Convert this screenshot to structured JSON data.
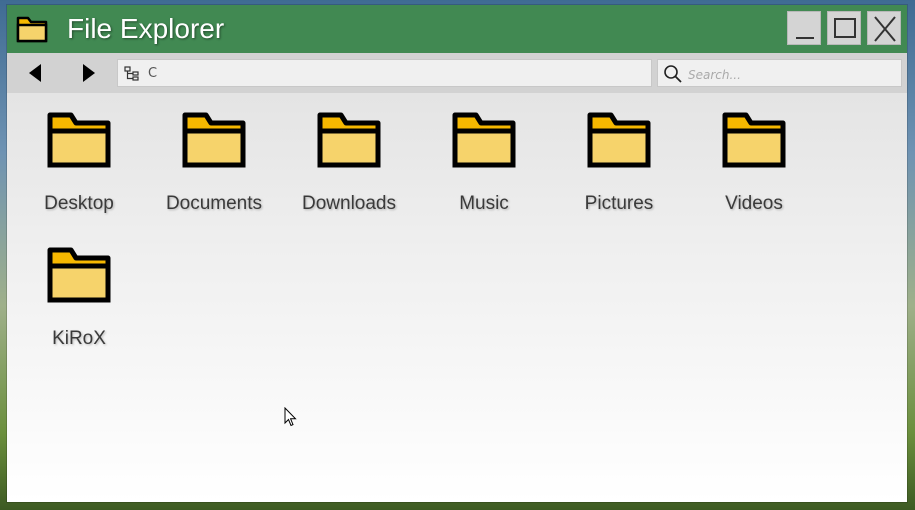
{
  "window": {
    "title": "File Explorer",
    "titlebar_color": "#418952",
    "controls": {
      "minimize": "_",
      "maximize": "□",
      "close": "X"
    }
  },
  "toolbar": {
    "back_icon": "triangle-left-icon",
    "forward_icon": "triangle-right-icon",
    "address": {
      "icon": "folder-tree-icon",
      "path": "C"
    },
    "search": {
      "icon": "magnifier-icon",
      "placeholder": "Search..."
    }
  },
  "folders": [
    {
      "label": "Desktop",
      "icon": "folder-icon"
    },
    {
      "label": "Documents",
      "icon": "folder-icon"
    },
    {
      "label": "Downloads",
      "icon": "folder-icon"
    },
    {
      "label": "Music",
      "icon": "folder-icon"
    },
    {
      "label": "Pictures",
      "icon": "folder-icon"
    },
    {
      "label": "Videos",
      "icon": "folder-icon"
    },
    {
      "label": "KiRoX",
      "icon": "folder-icon"
    }
  ],
  "colors": {
    "folder_fill": "#f6d36b",
    "folder_tab": "#f6b800",
    "folder_outline": "#000000"
  }
}
